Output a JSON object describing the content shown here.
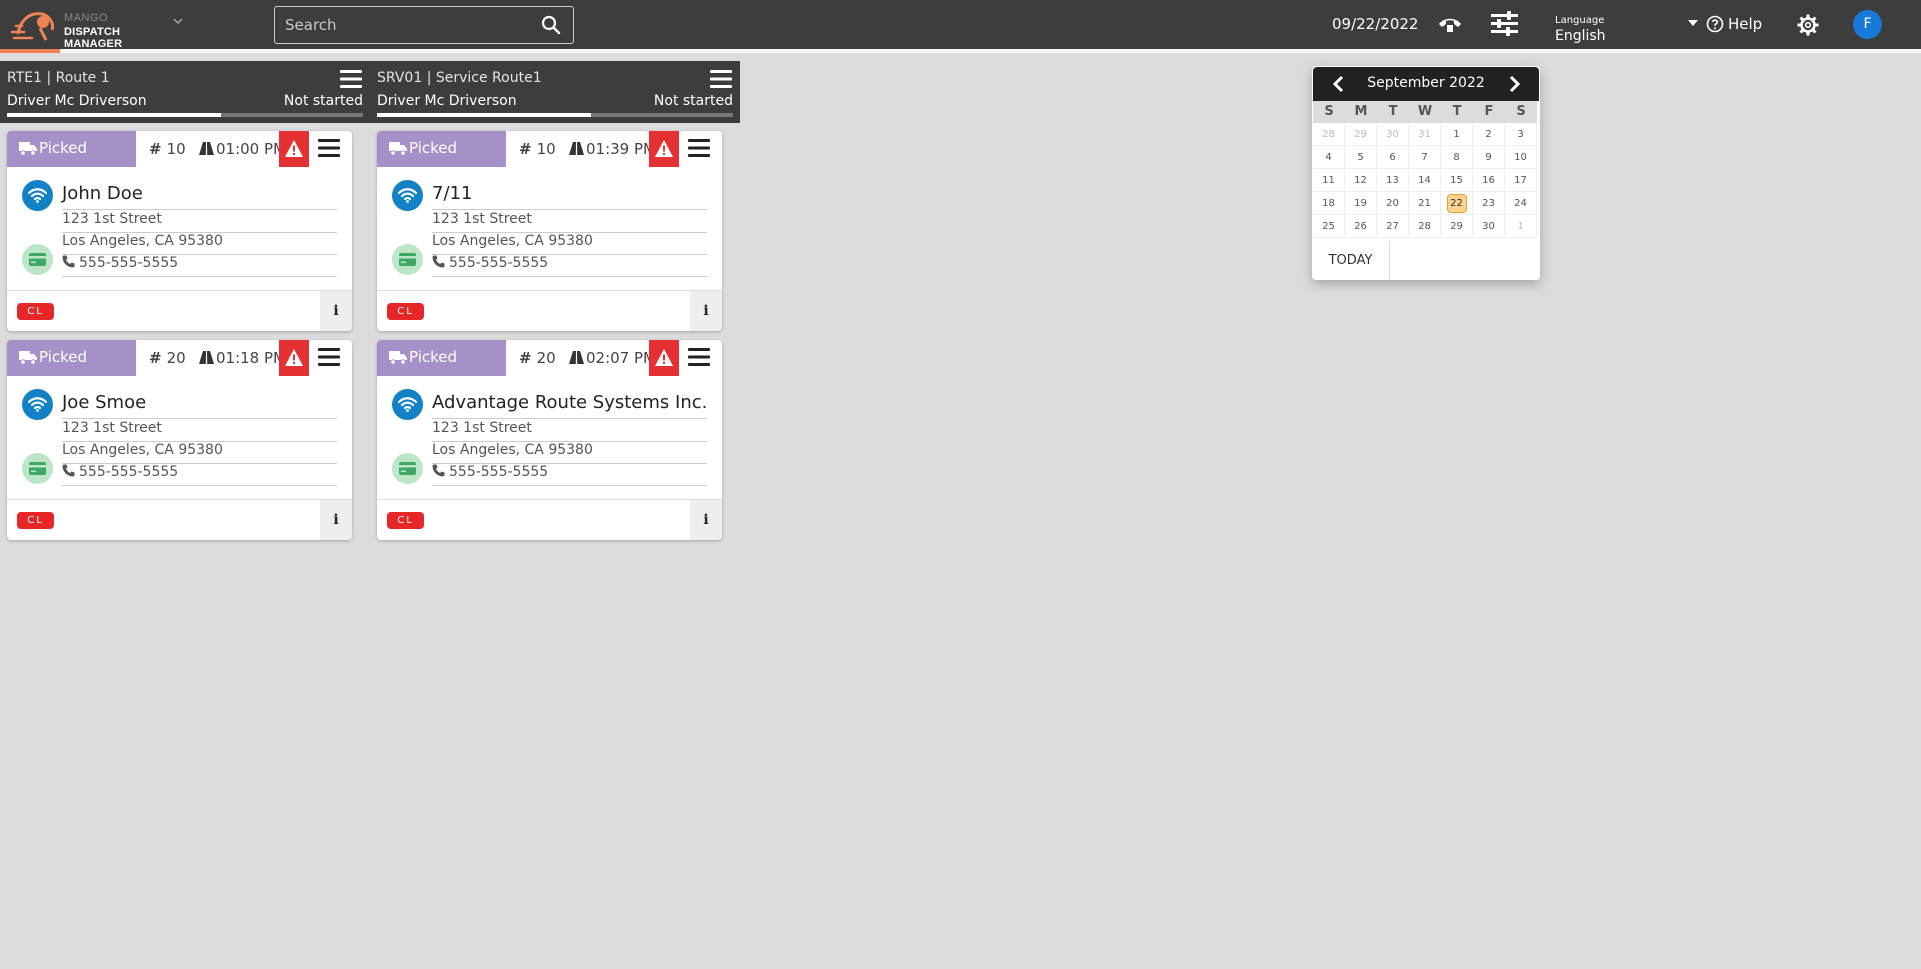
{
  "header": {
    "logo_top": "MANGO",
    "logo_bottom": "DISPATCH MANAGER",
    "search_placeholder": "Search",
    "date": "09/22/2022",
    "language_label": "Language",
    "language_value": "English",
    "help_label": "Help",
    "avatar_initial": "F"
  },
  "routes": [
    {
      "code": "RTE1 | Route 1",
      "driver": "Driver Mc Driverson",
      "status": "Not started",
      "progress": 0.6,
      "stops": [
        {
          "status": "Picked",
          "number": "10",
          "eta": "01:00 PM",
          "name": "John Doe",
          "street": "123 1st Street",
          "city": "Los Angeles, CA 95380",
          "phone": "555-555-5555",
          "badge": "CL",
          "info": "i"
        },
        {
          "status": "Picked",
          "number": "20",
          "eta": "01:18 PM",
          "name": "Joe Smoe",
          "street": "123 1st Street",
          "city": "Los Angeles, CA 95380",
          "phone": "555-555-5555",
          "badge": "CL",
          "info": "i"
        }
      ]
    },
    {
      "code": "SRV01 | Service Route1",
      "driver": "Driver Mc Driverson",
      "status": "Not started",
      "progress": 0.6,
      "stops": [
        {
          "status": "Picked",
          "number": "10",
          "eta": "01:39 PM",
          "name": "7/11",
          "street": "123 1st Street",
          "city": "Los Angeles, CA 95380",
          "phone": "555-555-5555",
          "badge": "CL",
          "info": "i"
        },
        {
          "status": "Picked",
          "number": "20",
          "eta": "02:07 PM",
          "name": "Advantage Route Systems Inc.",
          "street": "123 1st Street",
          "city": "Los Angeles, CA 95380",
          "phone": "555-555-5555",
          "badge": "CL",
          "info": "i"
        }
      ]
    }
  ],
  "calendar": {
    "title": "September 2022",
    "weekdays": [
      "S",
      "M",
      "T",
      "W",
      "T",
      "F",
      "S"
    ],
    "days": [
      {
        "d": "28",
        "muted": true
      },
      {
        "d": "29",
        "muted": true
      },
      {
        "d": "30",
        "muted": true
      },
      {
        "d": "31",
        "muted": true
      },
      {
        "d": "1"
      },
      {
        "d": "2"
      },
      {
        "d": "3"
      },
      {
        "d": "4"
      },
      {
        "d": "5"
      },
      {
        "d": "6"
      },
      {
        "d": "7"
      },
      {
        "d": "8"
      },
      {
        "d": "9"
      },
      {
        "d": "10"
      },
      {
        "d": "11"
      },
      {
        "d": "12"
      },
      {
        "d": "13"
      },
      {
        "d": "14"
      },
      {
        "d": "15"
      },
      {
        "d": "16"
      },
      {
        "d": "17"
      },
      {
        "d": "18"
      },
      {
        "d": "19"
      },
      {
        "d": "20"
      },
      {
        "d": "21"
      },
      {
        "d": "22",
        "today": true
      },
      {
        "d": "23"
      },
      {
        "d": "24"
      },
      {
        "d": "25"
      },
      {
        "d": "26"
      },
      {
        "d": "27"
      },
      {
        "d": "28"
      },
      {
        "d": "29"
      },
      {
        "d": "30"
      },
      {
        "d": "1",
        "muted": true
      }
    ],
    "today_label": "TODAY"
  },
  "colors": {
    "topbar": "#3d3d3d",
    "accent": "#ef8354",
    "picked": "#a591c8",
    "alert": "#e63134",
    "wifi": "#1281c6",
    "payment": "#bde5c8",
    "badge": "#e62627",
    "avatar": "#1979d9",
    "today_highlight": "#fcd28f"
  },
  "icons": {
    "logo": "mango-logo-icon",
    "search": "search-icon",
    "phone": "phone-icon",
    "filters": "sliders-icon",
    "help": "help-icon",
    "settings": "gear-icon",
    "truck": "truck-icon",
    "road": "road-icon",
    "alert": "alert-icon",
    "menu": "menu-icon",
    "wifi": "wifi-icon",
    "payment": "credit-card-icon"
  }
}
